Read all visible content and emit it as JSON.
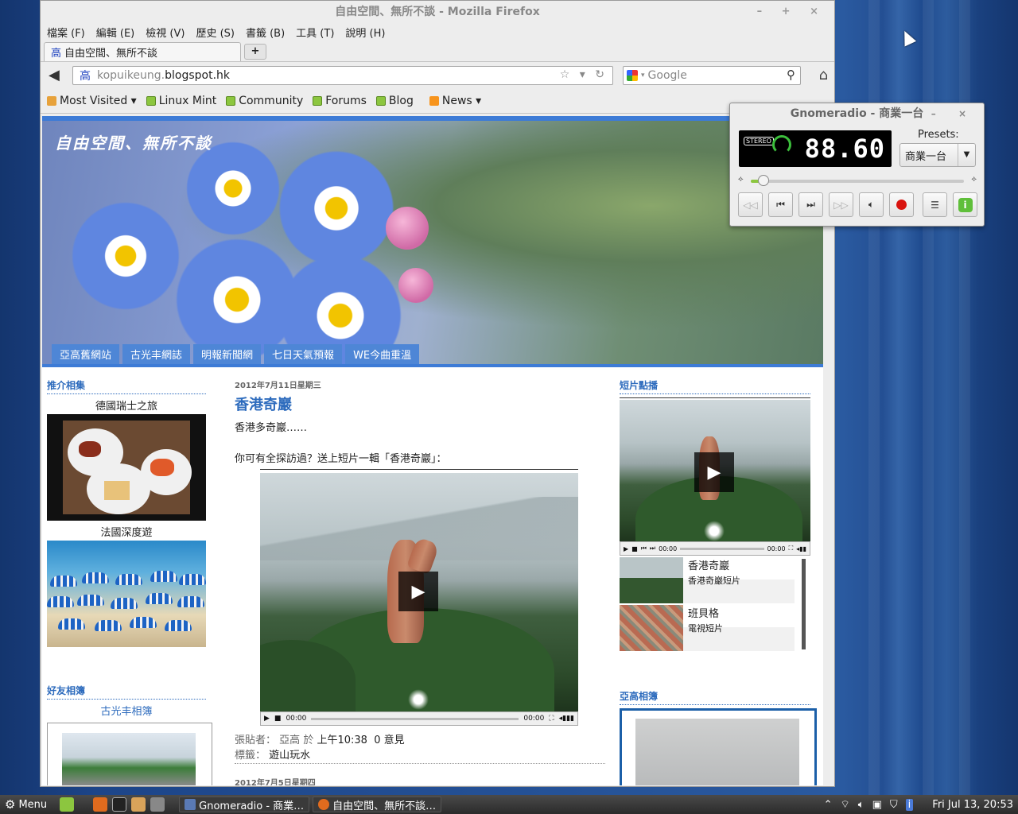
{
  "firefox": {
    "title": "自由空間、無所不談 - Mozilla Firefox",
    "window_buttons": "– + ×",
    "menu": [
      "檔案 (F)",
      "編輯 (E)",
      "檢視 (V)",
      "歷史 (S)",
      "書籤 (B)",
      "工具 (T)",
      "說明 (H)"
    ],
    "tab_title": "自由空間、無所不談",
    "tab_favicon": "高",
    "new_tab": "+",
    "url_prefix": "kopuikeung.",
    "url_domain": "blogspot.hk",
    "url_icons": "☆ ▾ ↻",
    "search_placeholder": "Google",
    "bookmarks": [
      "Most Visited ▾",
      "Linux Mint",
      "Community",
      "Forums",
      "Blog",
      "News ▾"
    ]
  },
  "blog": {
    "title": "自由空間、無所不談",
    "nav": [
      "亞高舊網站",
      "古光丰網誌",
      "明報新聞網",
      "七日天氣預報",
      "WE今曲重溫"
    ],
    "left": {
      "heading1": "推介相集",
      "album1": "德國瑞士之旅",
      "album2": "法國深度遊",
      "heading2": "好友相簿",
      "friend_album": "古光丰相簿"
    },
    "post": {
      "date": "2012年7月11日星期三",
      "title": "香港奇巖",
      "p1": "香港多奇巖……",
      "p2": "你可有全探訪過？送上短片一輯「香港奇巖」：",
      "time_left": "00:00",
      "time_right": "00:00",
      "meta_poster_label": "張貼者：",
      "meta_poster": "亞高",
      "meta_at": "於",
      "meta_time": "上午10:38",
      "meta_comments": "0 意見",
      "meta_labels_label": "標籤：",
      "meta_labels": "遊山玩水",
      "next_date": "2012年7月5日星期四"
    },
    "right": {
      "heading1": "短片點播",
      "time_left": "00:00",
      "time_right": "00:00",
      "playlist": [
        {
          "title": "香港奇巖",
          "sub": "香港奇巖短片"
        },
        {
          "title": "班貝格",
          "sub": "電視短片"
        }
      ],
      "heading2": "亞高相簿"
    }
  },
  "radio": {
    "title": "Gnomeradio - 商業一台",
    "window_buttons": "– ×",
    "stereo": "STEREO",
    "frequency": "88.60",
    "presets_label": "Presets:",
    "preset_selected": "商業一台",
    "volume_level": 0.06
  },
  "taskbar": {
    "menu": "Menu",
    "tasks": [
      "Gnomeradio - 商業…",
      "自由空間、無所不談…"
    ],
    "clock": "Fri Jul 13, 20:53"
  },
  "colors": {
    "accent": "#2d6bbd",
    "header_band": "#3d7bd6",
    "navtab": "#4e86d6",
    "desktop": "#1d4589"
  }
}
